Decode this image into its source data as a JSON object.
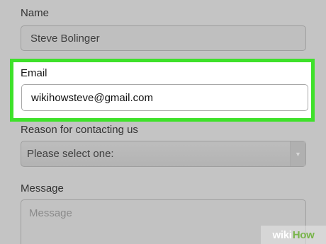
{
  "form": {
    "name": {
      "label": "Name",
      "value": "Steve Bolinger"
    },
    "email": {
      "label": "Email",
      "value": "wikihowsteve@gmail.com"
    },
    "reason": {
      "label": "Reason for contacting us",
      "selected": "Please select one:",
      "arrow_icon": "chevron-down-icon"
    },
    "message": {
      "label": "Message",
      "placeholder": "Message"
    }
  },
  "highlight_color": "#3ee12a",
  "watermark": {
    "part1": "wiki",
    "part2": "How"
  }
}
